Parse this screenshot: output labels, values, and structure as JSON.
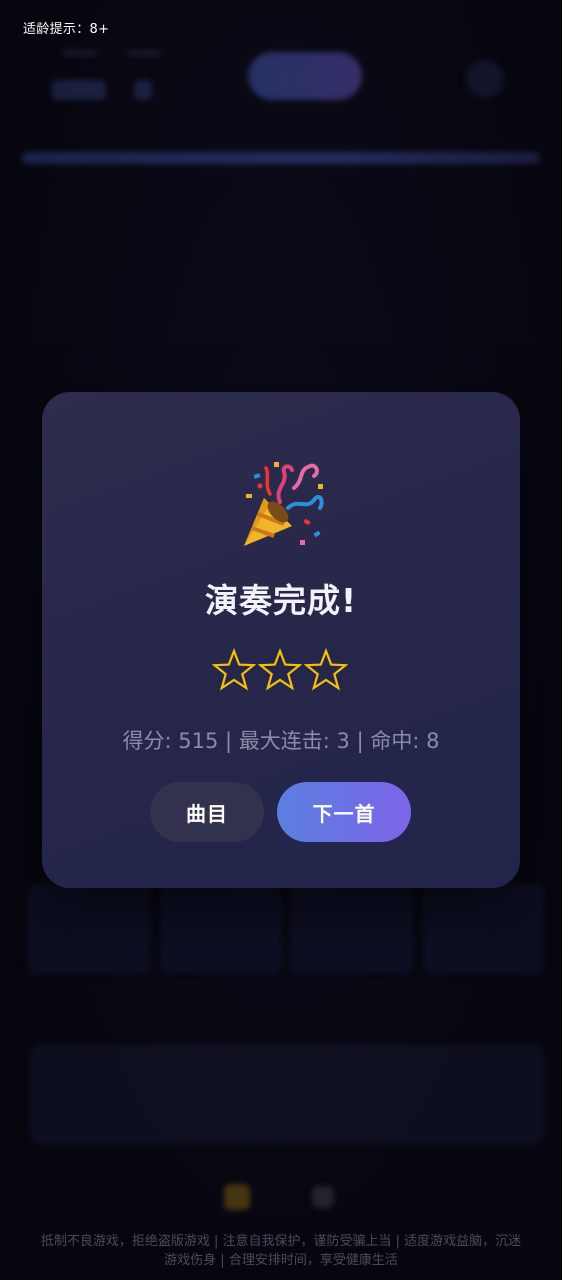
{
  "age_tip": "适龄提示：8+",
  "modal": {
    "icon": "party-popper-icon",
    "title": "演奏完成!",
    "stars_earned": 3,
    "stars_total": 3,
    "star_color": "#f4c20d",
    "stats_text": "得分: 515 | 最大连击: 3 | 命中: 8",
    "score": 515,
    "max_combo": 3,
    "hits": 8,
    "buttons": {
      "menu_label": "曲目",
      "next_label": "下一首"
    }
  },
  "footer": {
    "line1": "抵制不良游戏，拒绝盗版游戏 | 注意自我保护，谨防受骗上当 | 适度游戏益脑，沉迷",
    "line2": "游戏伤身 | 合理安排时间，享受健康生活"
  },
  "colors": {
    "background": "#07060f",
    "modal": "#2a2a4c",
    "accent_start": "#5a7fe0",
    "accent_end": "#7d64e8"
  }
}
